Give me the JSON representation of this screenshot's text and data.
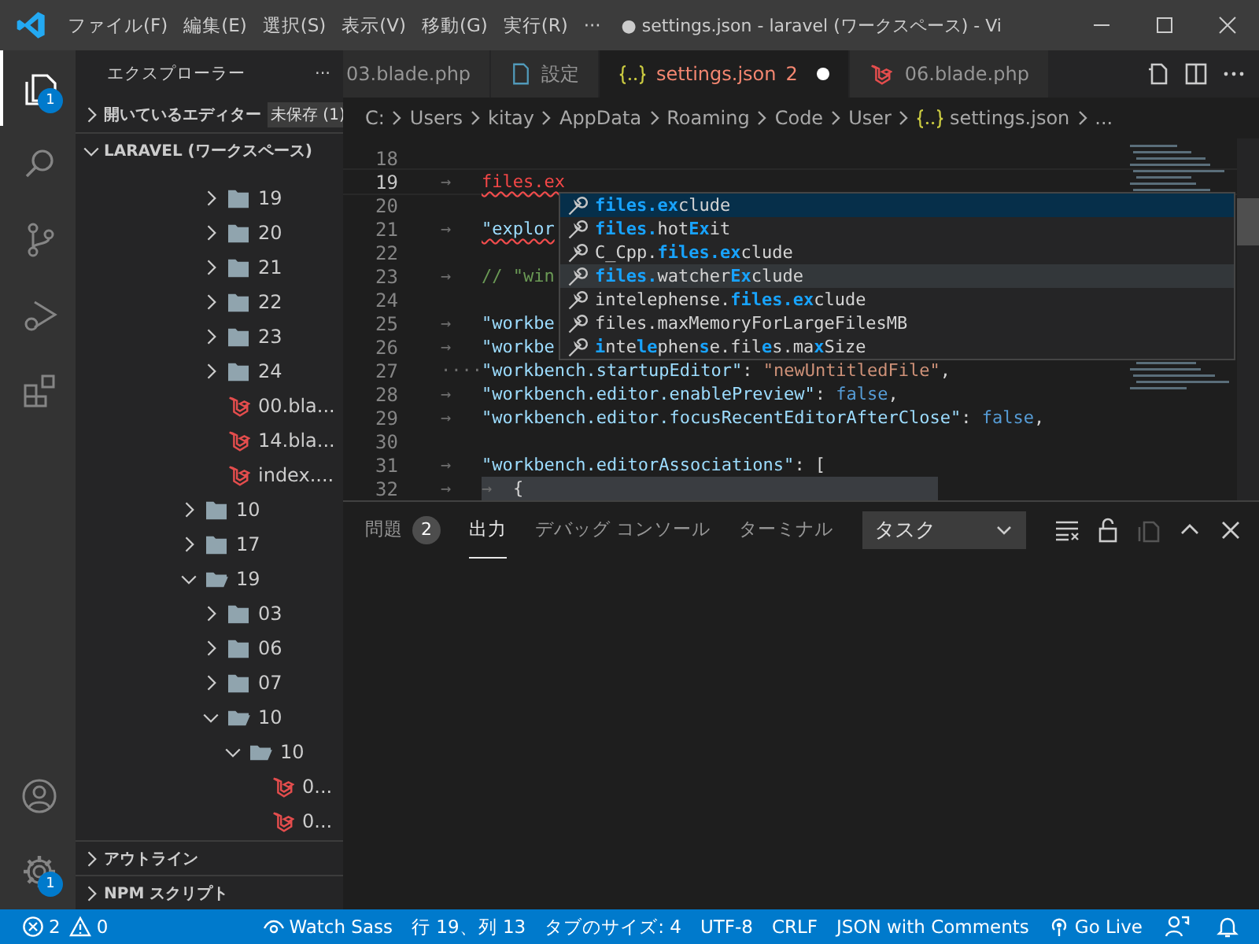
{
  "title_bar": {
    "menu": [
      "ファイル(F)",
      "編集(E)",
      "選択(S)",
      "表示(V)",
      "移動(G)",
      "実行(R)",
      "···"
    ],
    "title": "● settings.json - laravel (ワークスペース) - Vi"
  },
  "activity_bar": {
    "items": [
      {
        "selected": true,
        "badge": "1"
      },
      {
        "selected": false
      },
      {
        "selected": false
      },
      {
        "selected": false
      },
      {
        "selected": false
      }
    ],
    "settings_badge": "1"
  },
  "sidebar": {
    "title": "エクスプローラー",
    "more": "···",
    "open_editors": {
      "label": "開いているエディター",
      "expanded": false,
      "badge": "未保存 (1)"
    },
    "workspace": {
      "label": "LARAVEL (ワークスペース)",
      "expanded": true
    },
    "tree": [
      {
        "kind": "continued",
        "children": [
          {
            "kind": "folder",
            "label": "19",
            "expanded": false
          },
          {
            "kind": "folder",
            "label": "20",
            "expanded": false
          },
          {
            "kind": "folder",
            "label": "21",
            "expanded": false
          },
          {
            "kind": "folder",
            "label": "22",
            "expanded": false
          },
          {
            "kind": "folder",
            "label": "23",
            "expanded": false
          },
          {
            "kind": "folder",
            "label": "24",
            "expanded": false
          },
          {
            "kind": "file",
            "label": "00.bla..."
          },
          {
            "kind": "file",
            "label": "14.bla..."
          },
          {
            "kind": "file",
            "label": "index...."
          }
        ]
      },
      {
        "kind": "folder",
        "label": "10",
        "expanded": false
      },
      {
        "kind": "folder",
        "label": "17",
        "expanded": false
      },
      {
        "kind": "folder",
        "label": "19",
        "expanded": true,
        "children": [
          {
            "kind": "folder",
            "label": "03",
            "expanded": false
          },
          {
            "kind": "folder",
            "label": "06",
            "expanded": false
          },
          {
            "kind": "folder",
            "label": "07",
            "expanded": false
          },
          {
            "kind": "folder",
            "label": "10",
            "expanded": true,
            "children": [
              {
                "kind": "folder",
                "label": "10",
                "expanded": true,
                "children": [
                  {
                    "kind": "file",
                    "label": "0..."
                  },
                  {
                    "kind": "file",
                    "label": "0..."
                  }
                ]
              }
            ]
          }
        ]
      }
    ],
    "sections": [
      {
        "label": "アウトライン",
        "expanded": false
      },
      {
        "label": "NPM スクリプト",
        "expanded": false
      }
    ]
  },
  "tabs": [
    {
      "label": "03.blade.php",
      "kind": "plain",
      "selected": false
    },
    {
      "label": "設定",
      "kind": "settings",
      "selected": false
    },
    {
      "label": "settings.json",
      "kind": "json",
      "selected": true,
      "problems": "2",
      "dirty": true
    },
    {
      "label": "06.blade.php",
      "kind": "blade",
      "selected": false
    }
  ],
  "breadcrumbs": [
    "C:",
    "Users",
    "kitay",
    "AppData",
    "Roaming",
    "Code",
    "User",
    "settings.json",
    "..."
  ],
  "editor": {
    "lines": [
      {
        "number": "18",
        "current": false
      },
      {
        "number": "19",
        "current": true,
        "whitespace": "→",
        "tokens": [
          {
            "text": "files.ex",
            "kind": "invalid",
            "squiggle": true
          }
        ]
      },
      {
        "number": "20",
        "current": false
      },
      {
        "number": "21",
        "current": false,
        "whitespace": "→",
        "tokens": [
          {
            "text": "\"explor",
            "kind": "key",
            "squiggle": true
          }
        ]
      },
      {
        "number": "22",
        "current": false
      },
      {
        "number": "23",
        "current": false,
        "whitespace": "→",
        "tokens": [
          {
            "text": "// \"win",
            "kind": "comment"
          }
        ]
      },
      {
        "number": "24",
        "current": false
      },
      {
        "number": "25",
        "current": false,
        "whitespace": "→",
        "tokens": [
          {
            "text": "\"workbe",
            "kind": "key"
          }
        ]
      },
      {
        "number": "26",
        "current": false,
        "whitespace": "→",
        "tokens": [
          {
            "text": "\"workbe",
            "kind": "key"
          }
        ]
      },
      {
        "number": "27",
        "current": false,
        "whitespace": "····",
        "tokens": [
          {
            "text": "\"workbench.startupEditor\"",
            "kind": "key"
          },
          {
            "text": ": ",
            "kind": "punct"
          },
          {
            "text": "\"newUntitledFile\"",
            "kind": "string"
          },
          {
            "text": ",",
            "kind": "punct"
          }
        ]
      },
      {
        "number": "28",
        "current": false,
        "whitespace": "→",
        "tokens": [
          {
            "text": "\"workbench.editor.enablePreview\"",
            "kind": "key"
          },
          {
            "text": ": ",
            "kind": "punct"
          },
          {
            "text": "false",
            "kind": "keyword"
          },
          {
            "text": ",",
            "kind": "punct"
          }
        ]
      },
      {
        "number": "29",
        "current": false,
        "whitespace": "→",
        "tokens": [
          {
            "text": "\"workbench.editor.focusRecentEditorAfterClose\"",
            "kind": "key"
          },
          {
            "text": ": ",
            "kind": "punct"
          },
          {
            "text": "false",
            "kind": "keyword"
          },
          {
            "text": ",",
            "kind": "punct"
          }
        ]
      },
      {
        "number": "30",
        "current": false
      },
      {
        "number": "31",
        "current": false,
        "whitespace": "→",
        "tokens": [
          {
            "text": "\"workbench.editorAssociations\"",
            "kind": "key"
          },
          {
            "text": ": [",
            "kind": "punct"
          }
        ]
      },
      {
        "number": "32",
        "current": false,
        "highlighted": true,
        "whitespace": "→",
        "whitespace_inner": "→",
        "tokens": [
          {
            "text": "{",
            "kind": "punct"
          }
        ]
      }
    ],
    "suggest": [
      {
        "selected": true,
        "hovered": false,
        "parts": [
          {
            "text": "files.ex",
            "match": true
          },
          {
            "text": "clude",
            "match": false
          }
        ]
      },
      {
        "selected": false,
        "hovered": false,
        "parts": [
          {
            "text": "files.",
            "match": true
          },
          {
            "text": "hot",
            "match": false
          },
          {
            "text": "Ex",
            "match": true
          },
          {
            "text": "it",
            "match": false
          }
        ]
      },
      {
        "selected": false,
        "hovered": false,
        "parts": [
          {
            "text": "C_Cpp.",
            "match": false
          },
          {
            "text": "files.ex",
            "match": true
          },
          {
            "text": "clude",
            "match": false
          }
        ]
      },
      {
        "selected": false,
        "hovered": true,
        "parts": [
          {
            "text": "files.",
            "match": true
          },
          {
            "text": "watcher",
            "match": false
          },
          {
            "text": "Ex",
            "match": true
          },
          {
            "text": "clude",
            "match": false
          }
        ]
      },
      {
        "selected": false,
        "hovered": false,
        "parts": [
          {
            "text": "intelephense.",
            "match": false
          },
          {
            "text": "files.ex",
            "match": true
          },
          {
            "text": "clude",
            "match": false
          }
        ]
      },
      {
        "selected": false,
        "hovered": false,
        "parts": [
          {
            "text": "files.maxMemoryForLargeFilesMB",
            "match": false
          }
        ]
      },
      {
        "selected": false,
        "hovered": false,
        "parts": [
          {
            "text": "i",
            "match": true
          },
          {
            "text": "nte",
            "match": false
          },
          {
            "text": "le",
            "match": true
          },
          {
            "text": "phen",
            "match": false
          },
          {
            "text": "s",
            "match": true
          },
          {
            "text": "e.fil",
            "match": false
          },
          {
            "text": "e",
            "match": true
          },
          {
            "text": "s.ma",
            "match": false
          },
          {
            "text": "x",
            "match": true
          },
          {
            "text": "Size",
            "match": false
          }
        ]
      }
    ]
  },
  "panel": {
    "tabs": [
      {
        "label": "問題",
        "badge": "2",
        "selected": false
      },
      {
        "label": "出力",
        "selected": true
      },
      {
        "label": "デバッグ コンソール",
        "selected": false
      },
      {
        "label": "ターミナル",
        "selected": false
      }
    ],
    "dropdown": "タスク"
  },
  "status_bar": {
    "errors": "2",
    "warnings": "0",
    "items": [
      "Watch Sass",
      "行 19、列 13",
      "タブのサイズ: 4",
      "UTF-8",
      "CRLF",
      "JSON with Comments",
      "Go Live"
    ]
  }
}
